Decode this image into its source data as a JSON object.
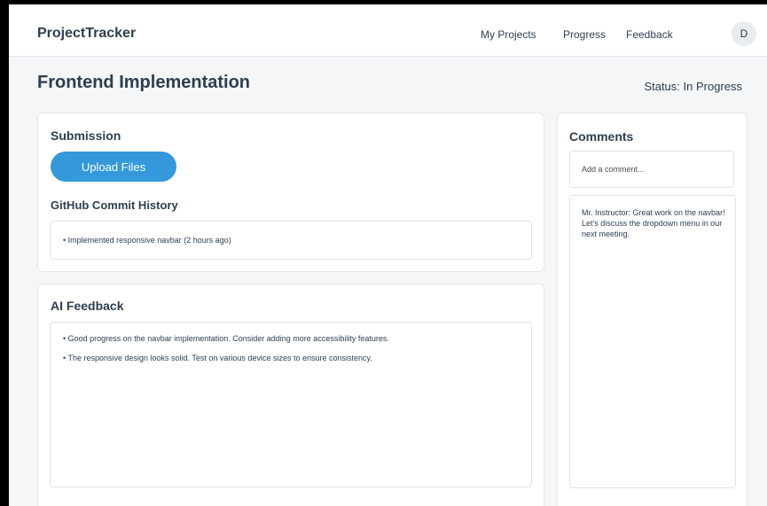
{
  "navbar": {
    "brand": "ProjectTracker",
    "links": [
      "My Projects",
      "Progress",
      "Feedback"
    ],
    "avatar_initial": "D"
  },
  "page": {
    "title": "Frontend Implementation",
    "status": "Status: In Progress"
  },
  "submission": {
    "title": "Submission",
    "upload_label": "Upload Files",
    "history_title": "GitHub Commit History",
    "commits": [
      "• Implemented responsive navbar (2 hours ago)"
    ]
  },
  "ai_feedback": {
    "title": "AI Feedback",
    "items": [
      "• Good progress on the navbar implementation. Consider adding more accessibility features.",
      "• The responsive design looks solid. Test on various device sizes to ensure consistency."
    ]
  },
  "comments": {
    "title": "Comments",
    "placeholder": "Add a comment...",
    "entries": [
      "Mr. Instructor: Great work on the navbar! Let's discuss the dropdown menu in our next meeting."
    ]
  },
  "colors": {
    "accent": "#3498db",
    "text": "#2c3e50",
    "background": "#f4f6f8"
  }
}
